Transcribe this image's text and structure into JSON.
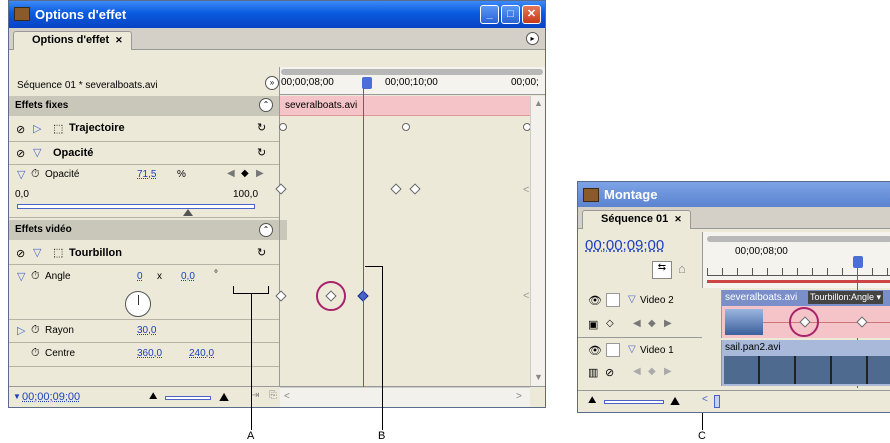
{
  "effect_window": {
    "title": "Options d'effet",
    "tab_label": "Options d'effet",
    "sequence_label": "Séquence 01 * severalboats.avi",
    "timecodes": [
      "00;00;08;00",
      "00;00;10;00",
      "00;00;"
    ],
    "clip_bar_label": "severalboats.avi",
    "fixed_effects_header": "Effets fixes",
    "motion_label": "Trajectoire",
    "opacity_header": "Opacité",
    "opacity_param_label": "Opacité",
    "opacity_value": "71,5",
    "opacity_unit": "%",
    "slider_min": "0,0",
    "slider_max": "100,0",
    "slider_level": 0.715,
    "video_effects_header": "Effets vidéo",
    "twirl_label": "Tourbillon",
    "angle_label": "Angle",
    "angle_turns": "0",
    "angle_x": "x",
    "angle_degrees": "0,0",
    "angle_deg_symbol": "°",
    "radius_label": "Rayon",
    "radius_value": "30,0",
    "center_label": "Centre",
    "center_x": "360,0",
    "center_y": "240,0",
    "current_time": "00;00;09;00"
  },
  "timeline_window": {
    "title": "Montage",
    "tab_label": "Séquence 01",
    "timecode": "00;00;09;00",
    "ruler_label": "00;00;08;00",
    "track2_label": "Video 2",
    "track1_label": "Video 1",
    "clip2_name": "severalboats.avi",
    "clip2_effect": "Tourbillon:Angle ▾",
    "clip1_name": "sail.pan2.avi"
  },
  "callouts": {
    "a": "A",
    "b": "B",
    "c": "C"
  },
  "colors": {
    "title_blue": "#0a5adf",
    "clip_pink": "#f4c4c8",
    "playhead_red": "#e03030",
    "highlight_magenta": "#a8236b"
  }
}
